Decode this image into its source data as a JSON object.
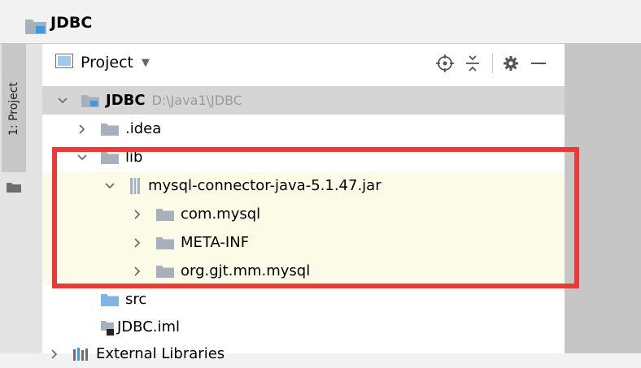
{
  "window": {
    "title": "JDBC"
  },
  "tool_strip": {
    "tab_label": "1: Project"
  },
  "toolbar": {
    "view_label": "Project",
    "caret": "▼"
  },
  "tree": [
    {
      "label": "JDBC",
      "path": "D:\\Java1\\JDBC"
    },
    {
      "label": ".idea"
    },
    {
      "label": "lib"
    },
    {
      "label": "mysql-connector-java-5.1.47.jar"
    },
    {
      "label": "com.mysql"
    },
    {
      "label": "META-INF"
    },
    {
      "label": "org.gjt.mm.mysql"
    },
    {
      "label": "src"
    },
    {
      "label": "JDBC.iml"
    },
    {
      "label": "External Libraries"
    }
  ],
  "colors": {
    "highlight_box": "#ea3a3a",
    "selected_row": "#d5d5d5",
    "jar_content_row": "#fbfbe8",
    "folder": "#a5b1bd",
    "module_accent": "#3b9ae1"
  },
  "icons": {
    "project_module": "project-folder-icon",
    "folder": "folder-icon",
    "jar": "jar-icon",
    "package": "package-folder-icon",
    "iml": "iml-file-icon",
    "libraries": "library-bars-icon"
  }
}
